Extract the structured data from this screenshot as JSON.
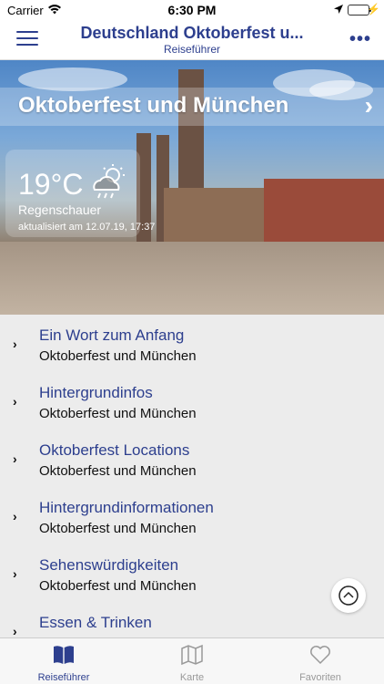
{
  "status_bar": {
    "carrier": "Carrier",
    "time": "6:30 PM"
  },
  "nav": {
    "title": "Deutschland Oktoberfest u...",
    "subtitle": "Reiseführer"
  },
  "hero": {
    "title": "Oktoberfest und München",
    "weather": {
      "temperature": "19°C",
      "description": "Regenschauer",
      "updated": "aktualisiert am 12.07.19, 17:37",
      "icon": "cloud-sun-rain-icon"
    }
  },
  "list": {
    "items": [
      {
        "title": "Ein Wort zum Anfang",
        "subtitle": "Oktoberfest und München"
      },
      {
        "title": "Hintergrundinfos",
        "subtitle": "Oktoberfest und München"
      },
      {
        "title": "Oktoberfest Locations",
        "subtitle": "Oktoberfest und München"
      },
      {
        "title": "Hintergrundinformationen",
        "subtitle": "Oktoberfest und München"
      },
      {
        "title": "Sehenswürdigkeiten",
        "subtitle": "Oktoberfest und München"
      },
      {
        "title": "Essen & Trinken",
        "subtitle": ""
      }
    ]
  },
  "tabs": [
    {
      "label": "Reiseführer",
      "icon": "book-icon",
      "active": true
    },
    {
      "label": "Karte",
      "icon": "map-icon",
      "active": false
    },
    {
      "label": "Favoriten",
      "icon": "heart-icon",
      "active": false
    }
  ],
  "colors": {
    "accent": "#2d3f8e",
    "background": "#ececec",
    "inactive_tab": "#999999"
  }
}
